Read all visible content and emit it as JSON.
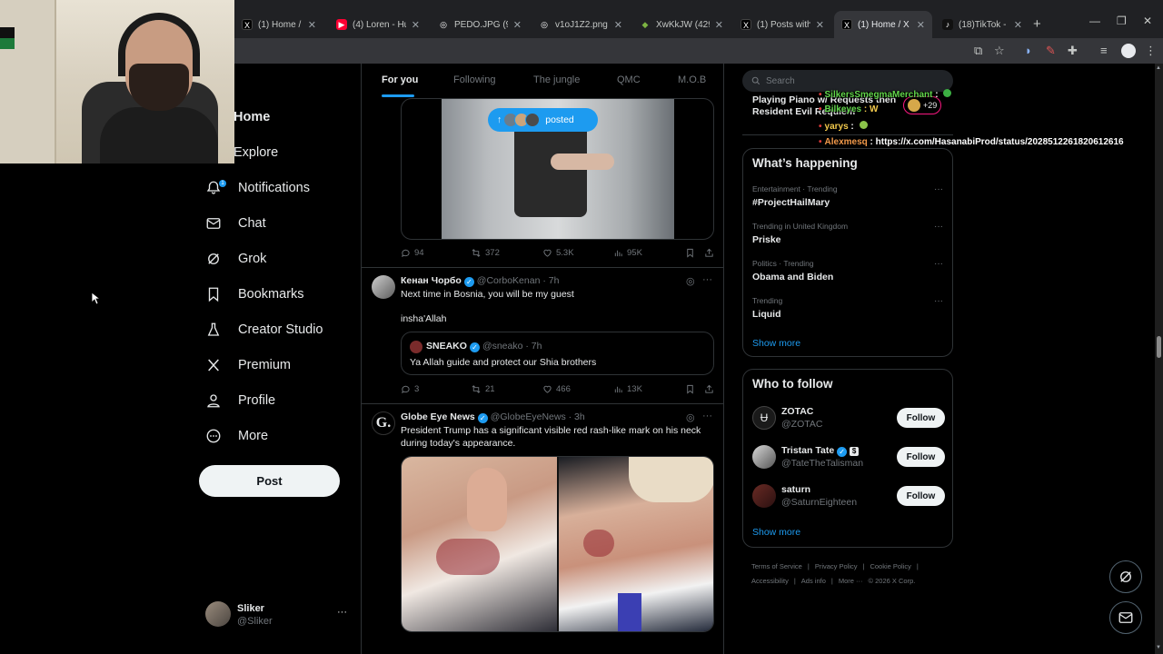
{
  "browser": {
    "tabs": [
      {
        "label": "(1) Home / X",
        "fav": "X",
        "fav_color": "#000000",
        "active": false
      },
      {
        "label": "(4) Loren - Hung",
        "fav": "▶",
        "fav_color": "#ff0033",
        "active": false
      },
      {
        "label": "PEDO.JPG (981×5",
        "fav": "◎",
        "fav_color": "#5f6368",
        "active": false
      },
      {
        "label": "v1oJ1Z2.png (112",
        "fav": "◎",
        "fav_color": "#5f6368",
        "active": false
      },
      {
        "label": "XwKkJW (429×44",
        "fav": "◆",
        "fav_color": "#7cb342",
        "active": false
      },
      {
        "label": "(1) Posts with rep",
        "fav": "X",
        "fav_color": "#000000",
        "active": false
      },
      {
        "label": "(1) Home / X",
        "fav": "X",
        "fav_color": "#000000",
        "active": true
      },
      {
        "label": "(18)TikTok - Make",
        "fav": "♪",
        "fav_color": "#111111",
        "active": false
      }
    ],
    "new_tab": "+",
    "minimize": "—",
    "restore": "❐",
    "close": "✕"
  },
  "nav": {
    "items": [
      {
        "label": "Home",
        "icon": "home-icon"
      },
      {
        "label": "Explore",
        "icon": "search-icon"
      },
      {
        "label": "Notifications",
        "icon": "bell-icon",
        "badge": "1"
      },
      {
        "label": "Chat",
        "icon": "mail-icon"
      },
      {
        "label": "Grok",
        "icon": "grok-icon"
      },
      {
        "label": "Bookmarks",
        "icon": "bookmark-icon"
      },
      {
        "label": "Creator Studio",
        "icon": "flask-icon"
      },
      {
        "label": "Premium",
        "icon": "x-logo-icon"
      },
      {
        "label": "Profile",
        "icon": "person-icon"
      },
      {
        "label": "More",
        "icon": "more-circle-icon"
      }
    ],
    "post_label": "Post",
    "account": {
      "name": "Sliker",
      "handle": "@Sliker",
      "more": "···"
    }
  },
  "timeline": {
    "tabs": [
      "For you",
      "Following",
      "The jungle",
      "QMC",
      "M.O.B"
    ],
    "posted_pill": "posted",
    "tweet0_actions": {
      "replies": "94",
      "reposts": "372",
      "likes": "5.3K",
      "views": "95K"
    },
    "tweet1": {
      "name": "Кенан Чорбо",
      "meta": "@CorboKenan · 7h",
      "line1": "Next time in Bosnia, you will be my guest",
      "line2": "insha'Allah",
      "quote": {
        "name": "SNEAKO",
        "meta": "@sneako · 7h",
        "text": "Ya Allah guide and protect our Shia brothers"
      },
      "actions": {
        "replies": "3",
        "reposts": "21",
        "likes": "466",
        "views": "13K"
      }
    },
    "tweet2": {
      "name": "Globe Eye News",
      "meta": "@GlobeEyeNews · 3h",
      "line1": "President Trump has a significant visible red rash-like mark on his neck",
      "line2": "during today's appearance.",
      "avatar_letter": "G."
    }
  },
  "right": {
    "search_placeholder": "Search",
    "peek_line1": "Playing Piano w/ Requests then",
    "peek_line2": "Resident Evil Requiem",
    "peek_badge": "+29",
    "whats_happening": {
      "title": "What’s happening",
      "trends": [
        {
          "meta": "Entertainment · Trending",
          "name": "#ProjectHailMary"
        },
        {
          "meta": "Trending in United Kingdom",
          "name": "Priske"
        },
        {
          "meta": "Politics · Trending",
          "name": "Obama and Biden"
        },
        {
          "meta": "Trending",
          "name": "Liquid"
        }
      ],
      "show_more": "Show more"
    },
    "who_to_follow": {
      "title": "Who to follow",
      "people": [
        {
          "name": "ZOTAC",
          "handle": "@ZOTAC",
          "verified": false
        },
        {
          "name": "Tristan Tate",
          "handle": "@TateTheTalisman",
          "verified": true
        },
        {
          "name": "saturn",
          "handle": "@SaturnEighteen",
          "verified": false
        }
      ],
      "follow_label": "Follow",
      "show_more": "Show more"
    },
    "footer": [
      "Terms of Service",
      "|",
      "Privacy Policy",
      "|",
      "Cookie Policy",
      "|",
      "Accessibility",
      "|",
      "Ads info",
      "|",
      "More ···",
      "© 2026 X Corp."
    ]
  },
  "chat_overlay": [
    {
      "user": "SilkersSmegmaMerchant",
      "msg": " :",
      "color": "#62d64b"
    },
    {
      "user": "Bilkeyes",
      "msg": " : W",
      "color": "#62d64b"
    },
    {
      "user": "yarys",
      "msg": " :",
      "color": "#f2c94c"
    },
    {
      "user": "Alexmesq",
      "msg": " : https://x.com/HasanabiProd/status/2028512261820612616",
      "color": "#f2994a"
    }
  ]
}
